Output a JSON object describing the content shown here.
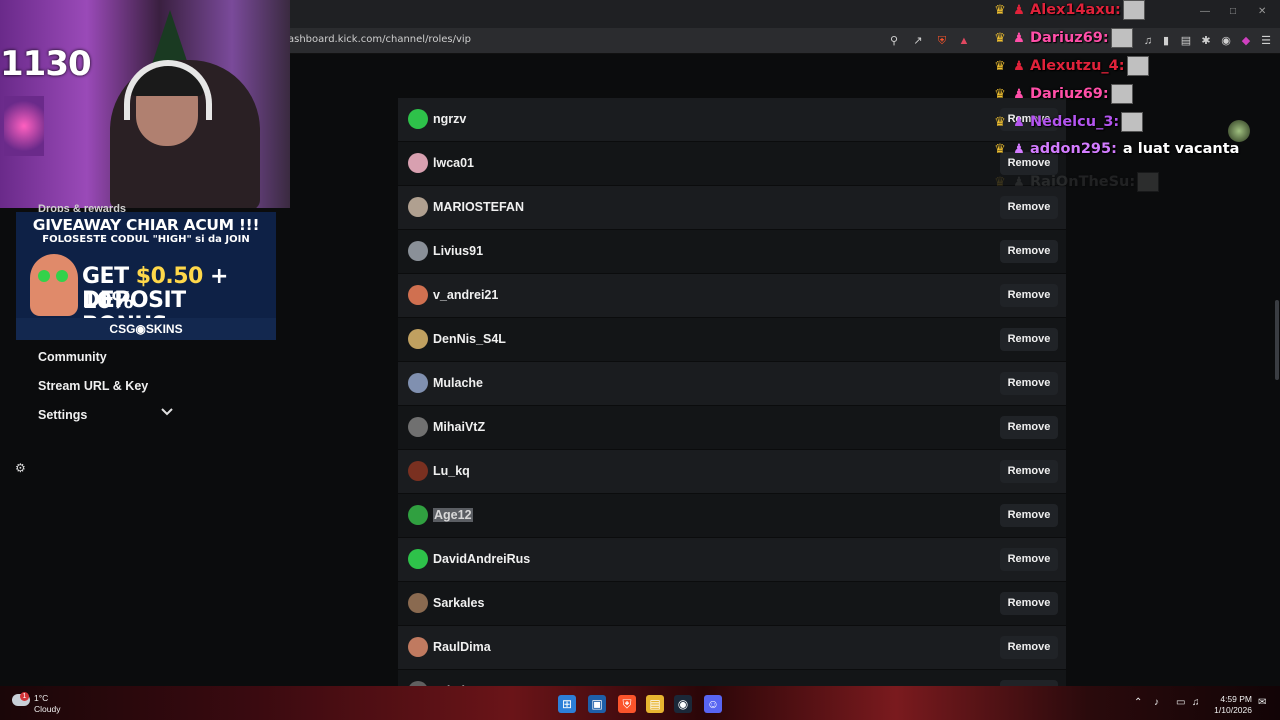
{
  "browser": {
    "url": "ashboard.kick.com/channel/roles/vip"
  },
  "nav": {
    "drops_label": "Drops & rewards",
    "community": "Community",
    "stream_url": "Stream URL & Key",
    "settings": "Settings"
  },
  "webcam": {
    "overlay_text": "1130"
  },
  "ad": {
    "line1": "GIVEAWAY CHIAR ACUM !!!",
    "line2": "FOLOSESTE CODUL \"HIGH\" si da JOIN",
    "line3_a": "GET ",
    "line3_b": "$0.50",
    "line3_c": " + 10%",
    "line4": "DEPOSIT BONUS",
    "brand": "CSG◉SKINS"
  },
  "vip_list": {
    "remove_label": "Remove",
    "rows": [
      {
        "name": "ngrzv",
        "avatar_color": "#2ec24a"
      },
      {
        "name": "lwca01",
        "avatar_color": "#d8a0b0"
      },
      {
        "name": "MARIOSTEFAN",
        "avatar_color": "#b0a090"
      },
      {
        "name": "Livius91",
        "avatar_color": "#8a9098"
      },
      {
        "name": "v_andrei21",
        "avatar_color": "#d07050"
      },
      {
        "name": "DenNis_S4L",
        "avatar_color": "#c0a060"
      },
      {
        "name": "Mulache",
        "avatar_color": "#8090b0"
      },
      {
        "name": "MihaiVtZ",
        "avatar_color": "#707070"
      },
      {
        "name": "Lu_kq",
        "avatar_color": "#7a3020"
      },
      {
        "name": "Age12",
        "avatar_color": "#30a040"
      },
      {
        "name": "DavidAndreiRus",
        "avatar_color": "#2ec24a"
      },
      {
        "name": "Sarkales",
        "avatar_color": "#8a6a50"
      },
      {
        "name": "RaulDima",
        "avatar_color": "#c07a60"
      },
      {
        "name": "Cristinaaa",
        "avatar_color": "#606060"
      }
    ]
  },
  "chat": [
    {
      "user": "Alex14axu:",
      "color": "#e0223a",
      "msg": "",
      "emote": true
    },
    {
      "user": "Dariuz69:",
      "color": "#ff4fa8",
      "msg": "",
      "emote": true
    },
    {
      "user": "Alexutzu_4:",
      "color": "#e0223a",
      "msg": "",
      "emote": true
    },
    {
      "user": "Dariuz69:",
      "color": "#ff4fa8",
      "msg": "",
      "emote": true
    },
    {
      "user": "Nedelcu_3:",
      "color": "#b455f0",
      "msg": "",
      "emote": true
    },
    {
      "user": "addon295:",
      "color": "#d37cff",
      "msg": "a luat vacanta",
      "emote": false
    },
    {
      "user": "RaiOnTheSu:",
      "color": "#888888",
      "msg": "",
      "emote": true
    }
  ],
  "taskbar": {
    "temp": "1°C",
    "weather": "Cloudy",
    "weather_badge": "1",
    "time": "4:59 PM",
    "date": "1/10/2026"
  },
  "colors": {
    "accent_green": "#22c55e",
    "row_dark": "#131517",
    "row_light": "#1a1c1f"
  }
}
